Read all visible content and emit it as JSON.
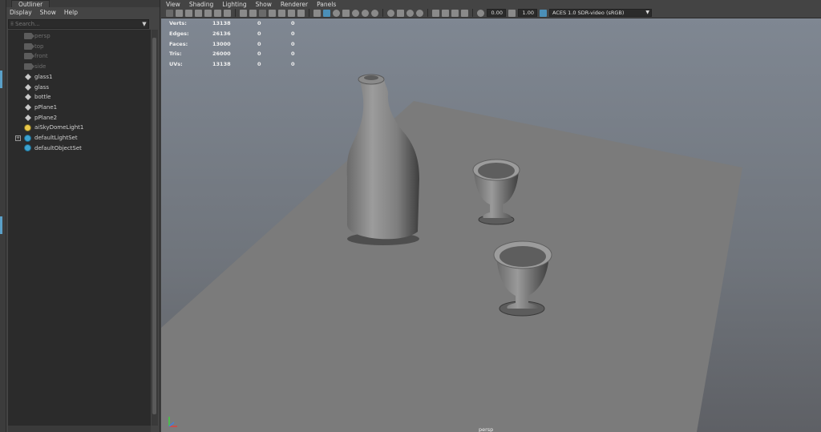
{
  "outliner": {
    "tab_label": "Outliner",
    "menus": [
      "Display",
      "Show",
      "Help"
    ],
    "search_placeholder": "Search...",
    "items": [
      {
        "label": "persp",
        "icon": "camera-icon",
        "dim": true,
        "expandable": false
      },
      {
        "label": "top",
        "icon": "camera-icon",
        "dim": true,
        "expandable": false
      },
      {
        "label": "front",
        "icon": "camera-icon",
        "dim": true,
        "expandable": false
      },
      {
        "label": "side",
        "icon": "camera-icon",
        "dim": true,
        "expandable": false
      },
      {
        "label": "glass1",
        "icon": "mesh-icon",
        "dim": false,
        "expandable": false
      },
      {
        "label": "glass",
        "icon": "mesh-icon",
        "dim": false,
        "expandable": false
      },
      {
        "label": "bottle",
        "icon": "mesh-icon",
        "dim": false,
        "expandable": false
      },
      {
        "label": "pPlane1",
        "icon": "mesh-icon",
        "dim": false,
        "expandable": false
      },
      {
        "label": "pPlane2",
        "icon": "mesh-icon",
        "dim": false,
        "expandable": false
      },
      {
        "label": "aiSkyDomeLight1",
        "icon": "light-icon",
        "dim": false,
        "expandable": false
      },
      {
        "label": "defaultLightSet",
        "icon": "set-icon",
        "dim": false,
        "expandable": true
      },
      {
        "label": "defaultObjectSet",
        "icon": "set-icon",
        "dim": false,
        "expandable": false
      }
    ]
  },
  "viewport": {
    "menus": [
      "View",
      "Shading",
      "Lighting",
      "Show",
      "Renderer",
      "Panels"
    ],
    "exposure_value": "0.00",
    "gamma_value": "1.00",
    "color_space": "ACES 1.0 SDR-video (sRGB)",
    "camera_label": "persp",
    "hud": [
      {
        "label": "Verts:",
        "values": [
          "13138",
          "0",
          "0"
        ]
      },
      {
        "label": "Edges:",
        "values": [
          "26136",
          "0",
          "0"
        ]
      },
      {
        "label": "Faces:",
        "values": [
          "13000",
          "0",
          "0"
        ]
      },
      {
        "label": "Tris:",
        "values": [
          "26000",
          "0",
          "0"
        ]
      },
      {
        "label": "UVs:",
        "values": [
          "13138",
          "0",
          "0"
        ]
      }
    ],
    "accent_color": "#4b8fb8",
    "axis_colors": {
      "x": "#e04040",
      "y": "#40d040",
      "z": "#4080e0"
    }
  }
}
